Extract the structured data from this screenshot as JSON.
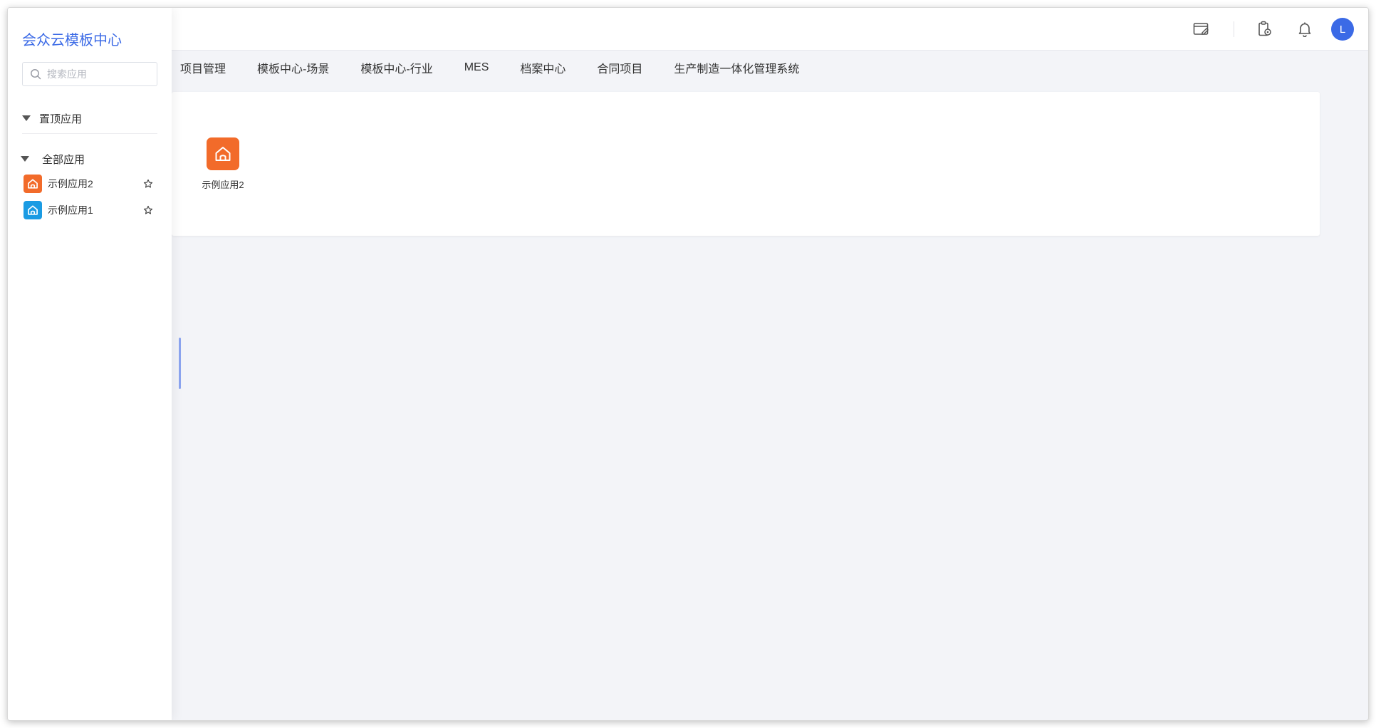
{
  "drawer": {
    "title": "会众云模板中心",
    "search_placeholder": "搜索应用",
    "pinned_label": "置顶应用",
    "all_label": "全部应用",
    "apps": [
      {
        "label": "示例应用2",
        "color": "#f26b2a",
        "icon": "home-icon",
        "star_icon": "star-outline-icon"
      },
      {
        "label": "示例应用1",
        "color": "#1a9be3",
        "icon": "home-icon",
        "star_icon": "star-outline-icon"
      }
    ]
  },
  "nav": {
    "tabs": [
      {
        "label": "项目管理"
      },
      {
        "label": "模板中心-场景"
      },
      {
        "label": "模板中心-行业"
      },
      {
        "label": "MES"
      },
      {
        "label": "档案中心"
      },
      {
        "label": "合同项目"
      },
      {
        "label": "生产制造一体化管理系统"
      }
    ]
  },
  "content": {
    "apps": [
      {
        "label": "示例应用2",
        "color": "#f26b2a",
        "icon": "home-icon"
      }
    ]
  },
  "header": {
    "icons": [
      "window-edit-icon",
      "clipboard-settings-icon",
      "bell-icon"
    ],
    "avatar_letter": "L",
    "avatar_color": "#3b6ae6"
  },
  "colors": {
    "accent": "#3b6ae6",
    "background": "#f3f4f8"
  }
}
